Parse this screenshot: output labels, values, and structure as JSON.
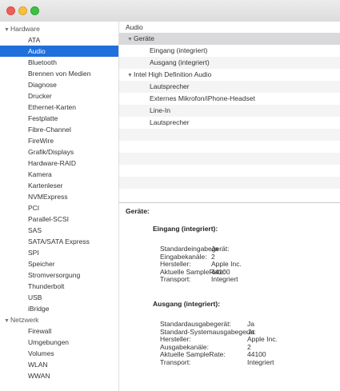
{
  "window": {
    "traffic_colors": {
      "close": "#f05d57",
      "minimize": "#f7c03e",
      "zoom": "#3dc144"
    }
  },
  "sidebar": {
    "accent": "#1f6fdc",
    "groups": [
      {
        "label": "Hardware",
        "items": [
          "ATA",
          "Audio",
          "Bluetooth",
          "Brennen von Medien",
          "Diagnose",
          "Drucker",
          "Ethernet-Karten",
          "Festplatte",
          "Fibre-Channel",
          "FireWire",
          "Grafik/Displays",
          "Hardware-RAID",
          "Kamera",
          "Kartenleser",
          "NVMExpress",
          "PCI",
          "Parallel-SCSI",
          "SAS",
          "SATA/SATA Express",
          "SPI",
          "Speicher",
          "Stromversorgung",
          "Thunderbolt",
          "USB",
          "iBridge"
        ]
      },
      {
        "label": "Netzwerk",
        "items": [
          "Firewall",
          "Umgebungen",
          "Volumes",
          "WLAN",
          "WWAN"
        ]
      }
    ],
    "selected": "Audio"
  },
  "pane": {
    "header": "Audio",
    "tree": [
      {
        "label": "Geräte",
        "level": 0,
        "expandable": true
      },
      {
        "label": "Eingang (integriert)",
        "level": 1
      },
      {
        "label": "Ausgang (integriert)",
        "level": 1
      },
      {
        "label": "Intel High Definition Audio",
        "level": 0,
        "expandable": true
      },
      {
        "label": "Lautsprecher",
        "level": 1
      },
      {
        "label": "Externes Mikrofon/iPhone-Headset",
        "level": 1
      },
      {
        "label": "Line-In",
        "level": 1
      },
      {
        "label": "Lautsprecher",
        "level": 1
      }
    ]
  },
  "detail": {
    "title": "Geräte:",
    "sections": [
      {
        "title": "Eingang (integriert):",
        "rows": [
          {
            "key": "Standardeingabegerät:",
            "value": "Ja"
          },
          {
            "key": "Eingabekanäle:",
            "value": "2"
          },
          {
            "key": "Hersteller:",
            "value": "Apple Inc."
          },
          {
            "key": "Aktuelle SampleRate:",
            "value": "44100"
          },
          {
            "key": "Transport:",
            "value": "Integriert"
          }
        ]
      },
      {
        "title": "Ausgang (integriert):",
        "rows": [
          {
            "key": "Standardausgabegerät:",
            "value": "Ja"
          },
          {
            "key": "Standard-Systemausgabegerät:",
            "value": "Ja"
          },
          {
            "key": "Hersteller:",
            "value": "Apple Inc."
          },
          {
            "key": "Ausgabekanäle:",
            "value": "2"
          },
          {
            "key": "Aktuelle SampleRate:",
            "value": "44100"
          },
          {
            "key": "Transport:",
            "value": "Integriert"
          }
        ]
      }
    ]
  }
}
